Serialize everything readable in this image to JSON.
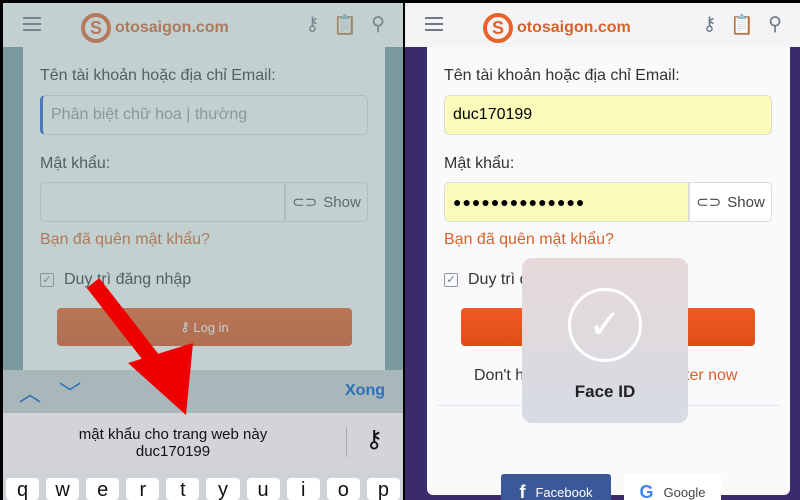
{
  "brand": {
    "name": "otosaigon.com",
    "accent": "#e8632a"
  },
  "left": {
    "username_label": "Tên tài khoản hoặc địa chỉ Email:",
    "username_placeholder": "Phân biệt chữ hoa | thường",
    "password_label": "Mật khẩu:",
    "show_label": "Show",
    "forgot": "Bạn đã quên mật khẩu?",
    "remember": "Duy trì đăng nhập",
    "login": "Log in",
    "done": "Xong",
    "suggest_title": "mật khẩu cho trang web này",
    "suggest_value": "duc170199",
    "keys": [
      "q",
      "w",
      "e",
      "r",
      "t",
      "y",
      "u",
      "i",
      "o",
      "p"
    ]
  },
  "right": {
    "username_label": "Tên tài khoản hoặc địa chỉ Email:",
    "username_value": "duc170199",
    "password_label": "Mật khẩu:",
    "password_value": "●●●●●●●●●●●●●●",
    "show_label": "Show",
    "forgot": "Bạn đã quên mật khẩu?",
    "remember": "Duy trì đ",
    "register_prefix": "Don't h",
    "register_link": "ter now",
    "faceid": "Face ID",
    "facebook": "Facebook",
    "google": "Google"
  }
}
